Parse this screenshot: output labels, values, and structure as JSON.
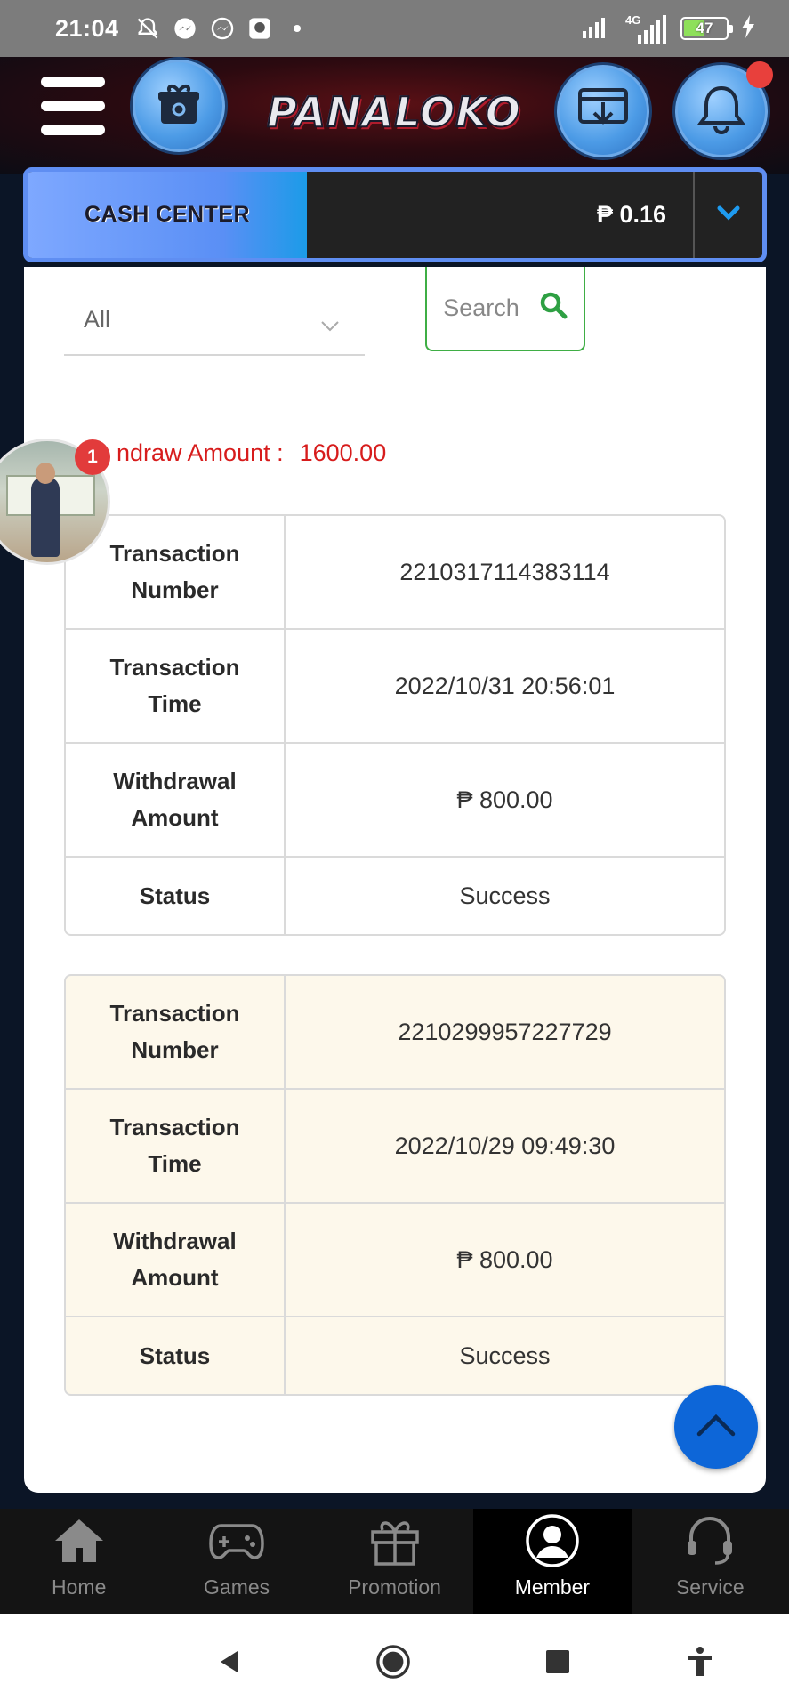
{
  "status_bar": {
    "time": "21:04",
    "network": "4G",
    "battery": "47",
    "icons": [
      "mute-bell-icon",
      "messenger-icon",
      "messenger-icon",
      "app-icon",
      "dot-icon",
      "signal-icon",
      "signal-icon",
      "charging-icon"
    ]
  },
  "header": {
    "brand": "PANALOKO",
    "buttons": [
      "menu-icon",
      "gift-icon",
      "download-icon",
      "bell-icon"
    ]
  },
  "cash_center": {
    "label": "CASH CENTER",
    "balance": "₱ 0.16"
  },
  "filter": {
    "selected": "All",
    "search_label": "Search"
  },
  "summary": {
    "label_visible": "ndraw Amount :",
    "value": "1600.00"
  },
  "transactions": [
    {
      "number_label": "Transaction Number",
      "number": "2210317114383114",
      "time_label": "Transaction Time",
      "time": "2022/10/31 20:56:01",
      "amount_label": "Withdrawal Amount",
      "amount": "₱ 800.00",
      "status_label": "Status",
      "status": "Success"
    },
    {
      "number_label": "Transaction Number",
      "number": "2210299957227729",
      "time_label": "Transaction Time",
      "time": "2022/10/29 09:49:30",
      "amount_label": "Withdrawal Amount",
      "amount": "₱ 800.00",
      "status_label": "Status",
      "status": "Success"
    }
  ],
  "chat": {
    "badge": "1"
  },
  "bottom_nav": {
    "items": [
      {
        "label": "Home",
        "icon": "home-icon"
      },
      {
        "label": "Games",
        "icon": "gamepad-icon"
      },
      {
        "label": "Promotion",
        "icon": "gift-icon"
      },
      {
        "label": "Member",
        "icon": "member-icon",
        "active": true
      },
      {
        "label": "Service",
        "icon": "headset-icon"
      }
    ]
  },
  "colors": {
    "accent_blue": "#0d66d8",
    "search_green": "#3fae45",
    "summary_red": "#d71c1c",
    "alt_row_bg": "#fdf8eb"
  }
}
